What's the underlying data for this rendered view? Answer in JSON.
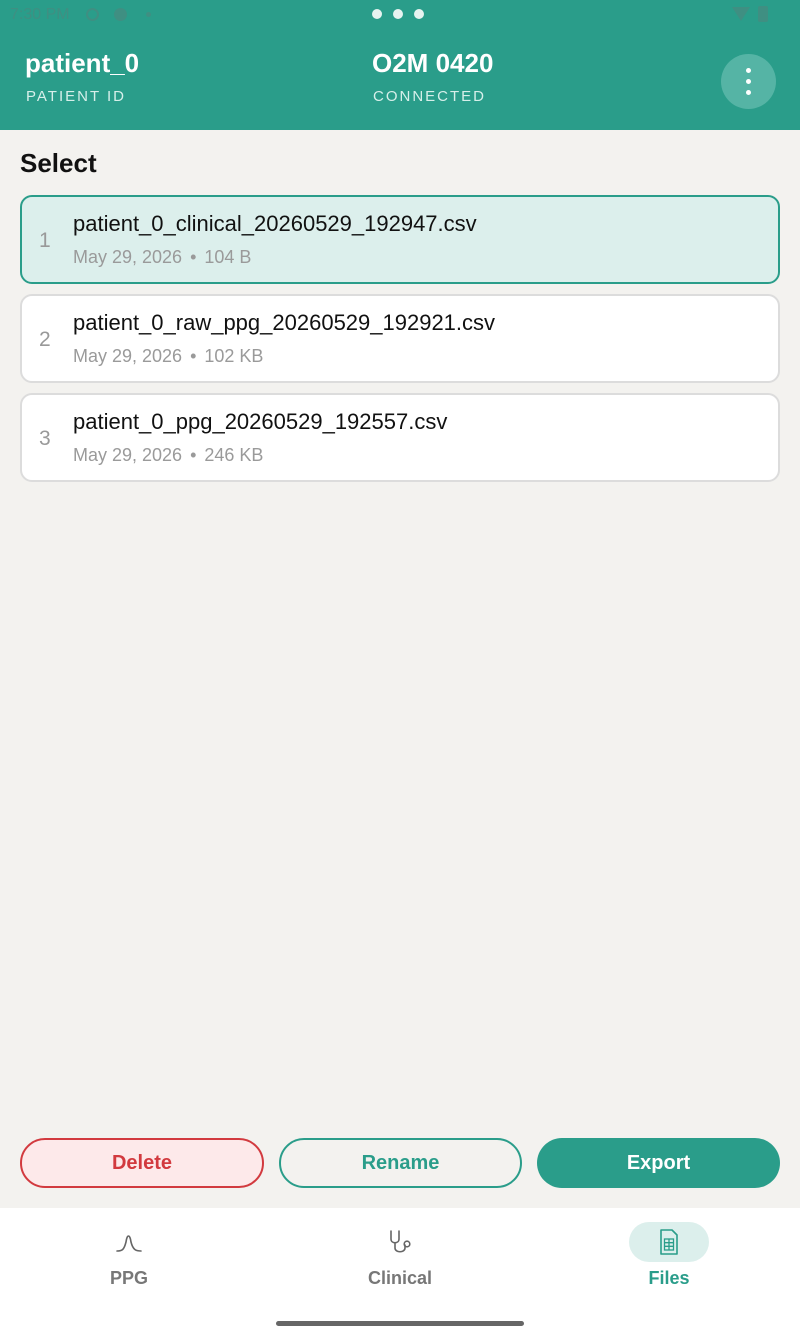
{
  "status_bar": {
    "time": "7:30 PM",
    "icons": [
      "alarm-icon",
      "data-saver-icon",
      "notification-dot-icon",
      "wifi-icon",
      "battery-icon"
    ]
  },
  "header": {
    "patient_id": "patient_0",
    "patient_id_label": "PATIENT ID",
    "device_name": "O2M 0420",
    "device_status": "CONNECTED",
    "menu_icon": "more-vert-icon"
  },
  "section": {
    "title": "Select"
  },
  "files": [
    {
      "index": "1",
      "name": "patient_0_clinical_20260529_192947.csv",
      "date": "May 29, 2026",
      "size": "104 B",
      "selected": true
    },
    {
      "index": "2",
      "name": "patient_0_raw_ppg_20260529_192921.csv",
      "date": "May 29, 2026",
      "size": "102 KB",
      "selected": false
    },
    {
      "index": "3",
      "name": "patient_0_ppg_20260529_192557.csv",
      "date": "May 29, 2026",
      "size": "246 KB",
      "selected": false
    }
  ],
  "actions": {
    "delete": "Delete",
    "rename": "Rename",
    "export": "Export"
  },
  "nav": {
    "items": [
      {
        "label": "PPG",
        "icon": "waveform-icon",
        "active": false
      },
      {
        "label": "Clinical",
        "icon": "stethoscope-icon",
        "active": false
      },
      {
        "label": "Files",
        "icon": "spreadsheet-file-icon",
        "active": true
      }
    ]
  },
  "colors": {
    "primary": "#2a9d8a",
    "selected_bg": "#dcefec",
    "danger": "#d23a3f",
    "background": "#f3f2ef"
  }
}
